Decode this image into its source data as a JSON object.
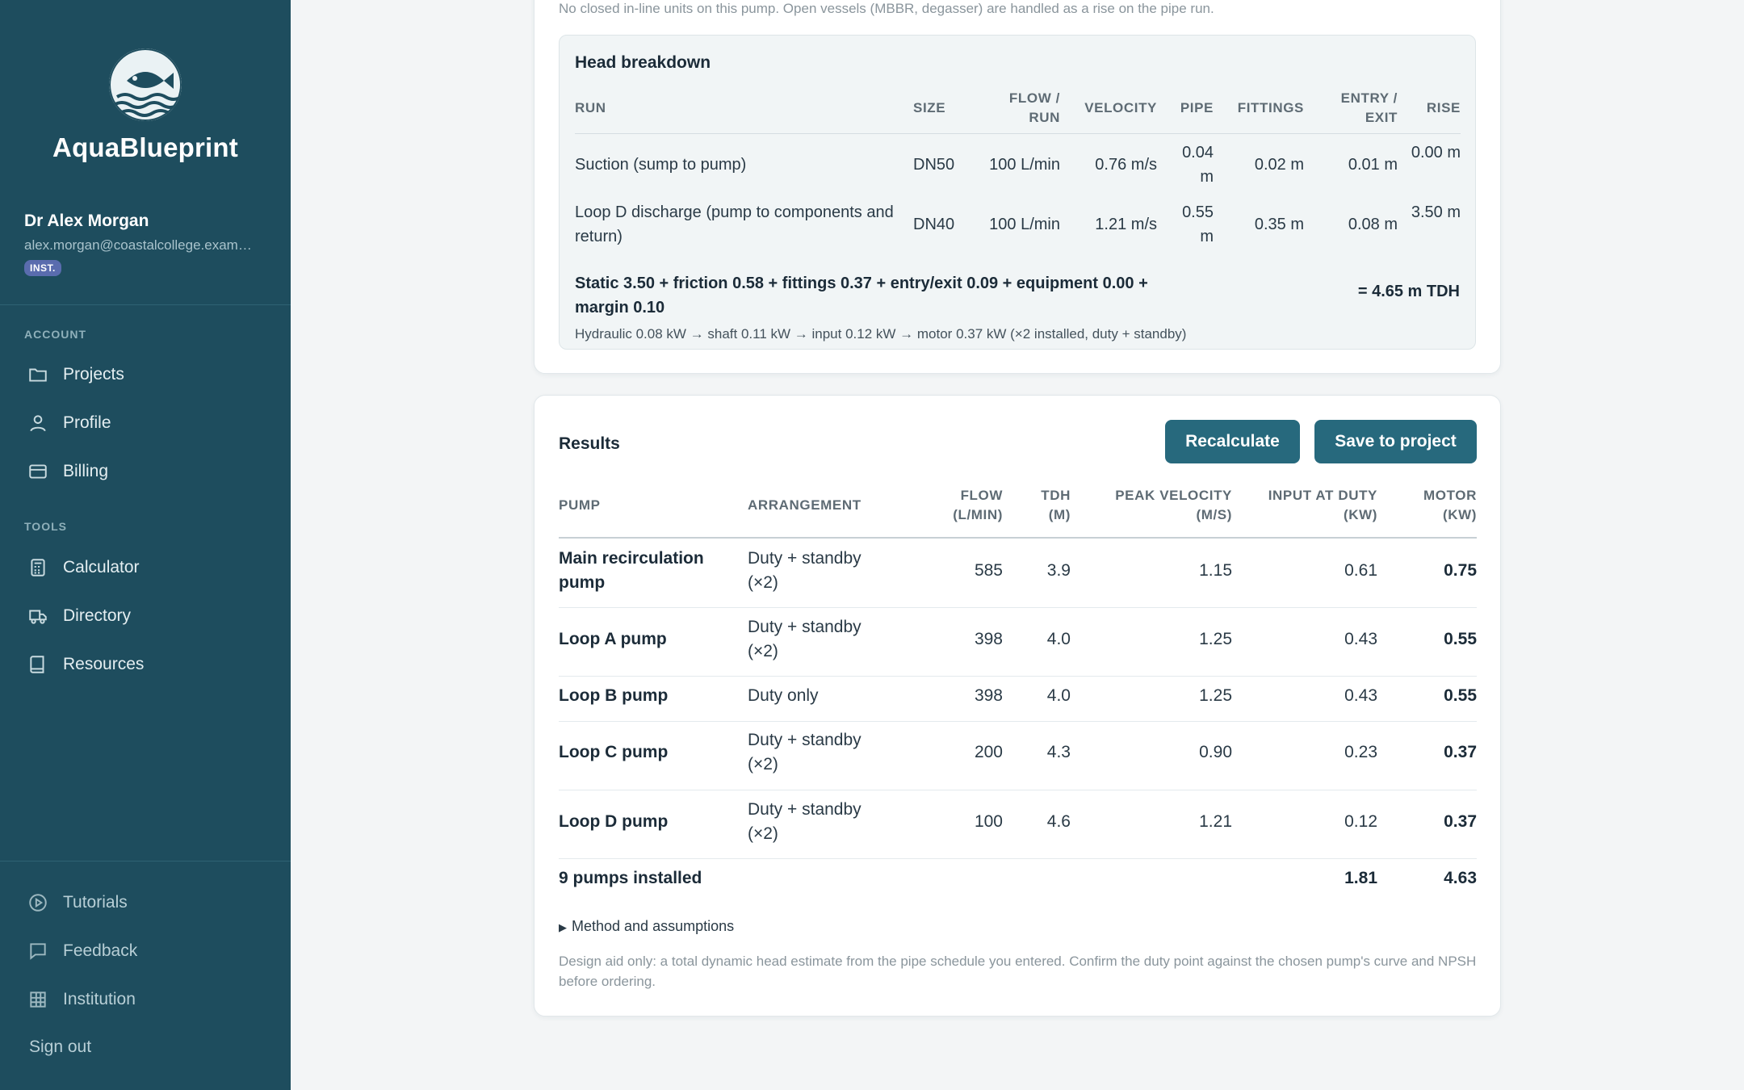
{
  "sidebar": {
    "brand": "AquaBlueprint",
    "user": {
      "name": "Dr Alex Morgan",
      "email": "alex.morgan@coastalcollege.exam…",
      "badge": "INST."
    },
    "account_label": "ACCOUNT",
    "account_items": [
      {
        "label": "Projects",
        "icon": "folder-icon"
      },
      {
        "label": "Profile",
        "icon": "user-icon"
      },
      {
        "label": "Billing",
        "icon": "credit-card-icon"
      }
    ],
    "tools_label": "TOOLS",
    "tools_items": [
      {
        "label": "Calculator",
        "icon": "calculator-icon"
      },
      {
        "label": "Directory",
        "icon": "truck-icon"
      },
      {
        "label": "Resources",
        "icon": "book-icon"
      }
    ],
    "bottom_items": [
      {
        "label": "Tutorials",
        "icon": "play-circle-icon"
      },
      {
        "label": "Feedback",
        "icon": "message-icon"
      },
      {
        "label": "Institution",
        "icon": "building-icon"
      }
    ],
    "signout": "Sign out"
  },
  "breakdown": {
    "top_note": "No closed in-line units on this pump. Open vessels (MBBR, degasser) are handled as a rise on the pipe run.",
    "title": "Head breakdown",
    "headers": {
      "run": "RUN",
      "size": "SIZE",
      "flow": "FLOW / RUN",
      "velocity": "VELOCITY",
      "pipe": "PIPE",
      "fittings": "FITTINGS",
      "entry": "ENTRY / EXIT",
      "rise": "RISE"
    },
    "rows": [
      {
        "run": "Suction (sump to pump)",
        "size": "DN50",
        "flow": "100 L/min",
        "velocity": "0.76 m/s",
        "pipe": "0.04 m",
        "fittings": "0.02 m",
        "entry": "0.01 m",
        "rise": "0.00 m"
      },
      {
        "run": "Loop D discharge (pump to components and return)",
        "size": "DN40",
        "flow": "100 L/min",
        "velocity": "1.21 m/s",
        "pipe": "0.55 m",
        "fittings": "0.35 m",
        "entry": "0.08 m",
        "rise": "3.50 m"
      }
    ],
    "formula": "Static 3.50 + friction 0.58 + fittings 0.37 + entry/exit 0.09 + equipment 0.00 + margin 0.10",
    "tdh": "= 4.65 m TDH",
    "hydraulic": "Hydraulic 0.08 kW → shaft 0.11 kW → input 0.12 kW → motor 0.37 kW (×2 installed, duty + standby)"
  },
  "results": {
    "title": "Results",
    "recalculate": "Recalculate",
    "save": "Save to project",
    "headers": {
      "pump": "PUMP",
      "arrangement": "ARRANGEMENT",
      "flow": "FLOW (L/MIN)",
      "tdh": "TDH (M)",
      "velocity": "PEAK VELOCITY (M/S)",
      "input": "INPUT AT DUTY (KW)",
      "motor": "MOTOR (KW)"
    },
    "rows": [
      {
        "pump": "Main recirculation pump",
        "arrangement": "Duty + standby (×2)",
        "flow": "585",
        "tdh": "3.9",
        "velocity": "1.15",
        "input": "0.61",
        "motor": "0.75"
      },
      {
        "pump": "Loop A pump",
        "arrangement": "Duty + standby (×2)",
        "flow": "398",
        "tdh": "4.0",
        "velocity": "1.25",
        "input": "0.43",
        "motor": "0.55"
      },
      {
        "pump": "Loop B pump",
        "arrangement": "Duty only",
        "flow": "398",
        "tdh": "4.0",
        "velocity": "1.25",
        "input": "0.43",
        "motor": "0.55"
      },
      {
        "pump": "Loop C pump",
        "arrangement": "Duty + standby (×2)",
        "flow": "200",
        "tdh": "4.3",
        "velocity": "0.90",
        "input": "0.23",
        "motor": "0.37"
      },
      {
        "pump": "Loop D pump",
        "arrangement": "Duty + standby (×2)",
        "flow": "100",
        "tdh": "4.6",
        "velocity": "1.21",
        "input": "0.12",
        "motor": "0.37"
      }
    ],
    "total": {
      "label": "9 pumps installed",
      "input": "1.81",
      "motor": "4.63"
    },
    "method": "Method and assumptions",
    "disclaimer": "Design aid only: a total dynamic head estimate from the pipe schedule you entered. Confirm the duty point against the chosen pump's curve and NPSH before ordering."
  }
}
